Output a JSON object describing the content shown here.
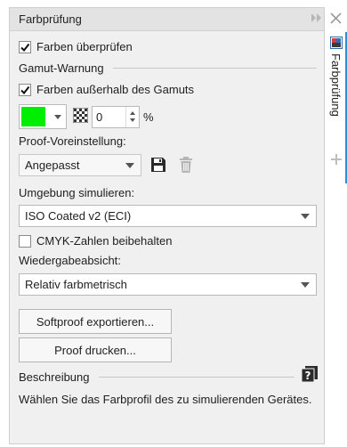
{
  "panel": {
    "title": "Farbprüfung",
    "forward_icon": "double-chevron-right-icon",
    "close_icon": "close-icon"
  },
  "check_colors": {
    "label": "Farben überprüfen",
    "checked": true
  },
  "gamut_section": {
    "title": "Gamut-Warnung"
  },
  "out_of_gamut": {
    "label": "Farben außerhalb des Gamuts",
    "checked": true
  },
  "gamut_color": {
    "swatch_color": "#00ee00"
  },
  "transparency": {
    "value": "0",
    "unit": "%"
  },
  "proof_preset": {
    "label": "Proof-Voreinstellung:",
    "value": "Angepasst",
    "save_icon": "save-icon",
    "delete_icon": "trash-icon"
  },
  "simulate_env": {
    "label": "Umgebung simulieren:",
    "value": "ISO Coated v2 (ECI)"
  },
  "preserve_cmyk": {
    "label": "CMYK-Zahlen beibehalten",
    "checked": false
  },
  "rendering_intent": {
    "label": "Wiedergabeabsicht:",
    "value": "Relativ farbmetrisch"
  },
  "buttons": {
    "export_softproof": "Softproof exportieren...",
    "print_proof": "Proof drucken..."
  },
  "description": {
    "title": "Beschreibung",
    "text": "Wählen Sie das Farbprofil des zu simulierenden Gerätes."
  },
  "sidebar": {
    "tab_label": "Farbprüfung",
    "add_icon": "plus-icon"
  },
  "colors": {
    "accent": "#2f8fd8",
    "panel_bg": "#f0f0f0",
    "swatch": "#00ee00"
  }
}
